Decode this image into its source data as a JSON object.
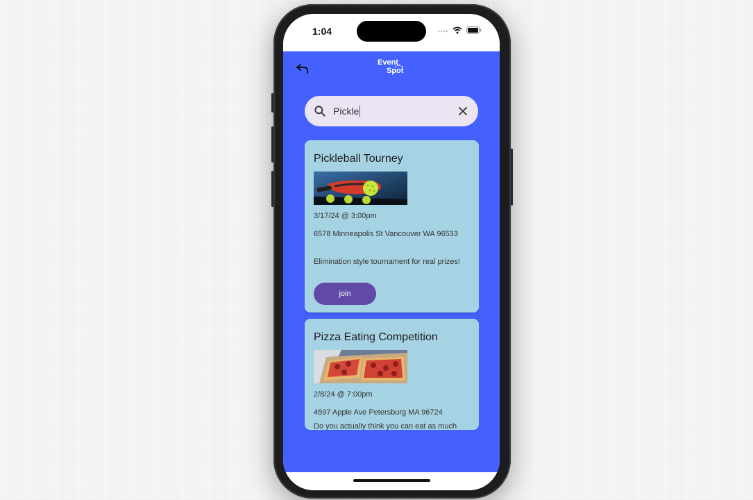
{
  "status_bar": {
    "time": "1:04"
  },
  "app_bar": {
    "logo_line1": "Event",
    "logo_line2": "Spot",
    "back_icon": "back-arrow-icon",
    "bar_color": "#4461ff"
  },
  "search": {
    "value": "Pickle",
    "search_icon": "search-icon",
    "clear_icon": "close-icon",
    "bg_color": "#ebe4f3"
  },
  "events": [
    {
      "title": "Pickleball Tourney",
      "image_icon": "pickleball-paddle-image",
      "date": "3/17/24 @ 3:00pm",
      "address": "6578  Minneapolis St Vancouver WA 96533",
      "description": "Elimination style tournament for real prizes!",
      "button_label": "join"
    },
    {
      "title": "Pizza Eating Competition",
      "image_icon": "pizza-image",
      "date": "2/8/24 @ 7:00pm",
      "address": "4597 Apple Ave  Petersburg MA 96724",
      "description": "Do you actually think you can eat as much"
    }
  ],
  "colors": {
    "card_bg": "#a6d3e3",
    "button_bg": "#6149a8",
    "background": "#4461ff"
  }
}
